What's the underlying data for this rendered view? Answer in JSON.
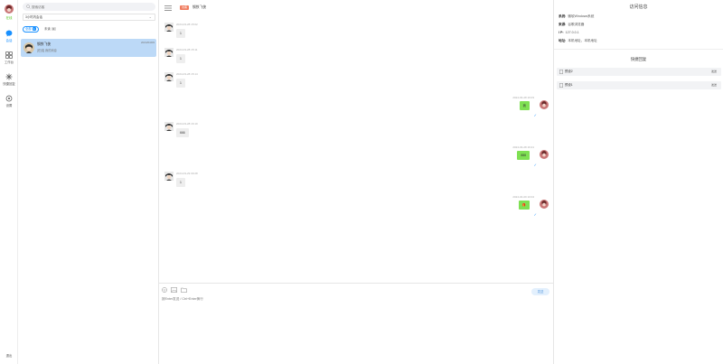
{
  "nav": {
    "status": "在线",
    "items": [
      {
        "label": "会话",
        "icon": "chat-bubble-icon",
        "active": true
      },
      {
        "label": "工作台",
        "icon": "grid-icon",
        "active": false
      },
      {
        "label": "快捷回复",
        "icon": "quick-reply-icon",
        "active": false
      },
      {
        "label": "设置",
        "icon": "gear-icon",
        "active": false
      }
    ],
    "logout": "退出"
  },
  "sessions": {
    "search_placeholder": "搜索访客",
    "selected_filter": "3小时内会话",
    "chips": {
      "all": "全部",
      "all_count": "1",
      "unread": "未读",
      "unread_count": "0"
    },
    "items": [
      {
        "name": "钢铁飞侠",
        "sub": "[在线] 我的消息",
        "time": "2024/04/09"
      }
    ]
  },
  "chat": {
    "tag": "访客",
    "title": "钢铁飞侠",
    "messages": [
      {
        "side": "left",
        "time": "2024-03-28 15:02",
        "text": "1"
      },
      {
        "side": "left",
        "time": "2024-03-28 15:11",
        "text": "1"
      },
      {
        "side": "left",
        "time": "2024-03-28 15:14",
        "text": "1"
      },
      {
        "side": "right",
        "time": "2024-03-28 16:03",
        "text": "我"
      },
      {
        "side": "left",
        "time": "2024-03-28 16:19",
        "text": "666"
      },
      {
        "side": "right",
        "time": "2024-03-28 16:21",
        "text": "888"
      },
      {
        "side": "left",
        "time": "2024-03-29 09:28",
        "text": "1"
      },
      {
        "side": "right",
        "time": "2024-04-09 10:04",
        "text": "🎁"
      }
    ],
    "send_label": "发送",
    "input_placeholder": "按Enter发送 / Ctrl+Enter换行"
  },
  "info": {
    "title": "访问信息",
    "rows": [
      {
        "k": "系统:",
        "v": "微软Windows系统"
      },
      {
        "k": "来源:",
        "v": "谷歌浏览器"
      },
      {
        "k": "I P:",
        "v": "127.0.0.1"
      },
      {
        "k": "地址:",
        "v": "本机地址，本机地址"
      }
    ],
    "quick_title": "快捷回复",
    "quick": [
      {
        "label": "预设2",
        "action": "发送"
      },
      {
        "label": "预设1",
        "action": "发送"
      }
    ]
  },
  "colors": {
    "accent": "#1890ff",
    "online": "#52c41a",
    "self_bubble": "#7fe053",
    "selected_session": "#bcd9f7",
    "tag": "#f07c5f"
  }
}
